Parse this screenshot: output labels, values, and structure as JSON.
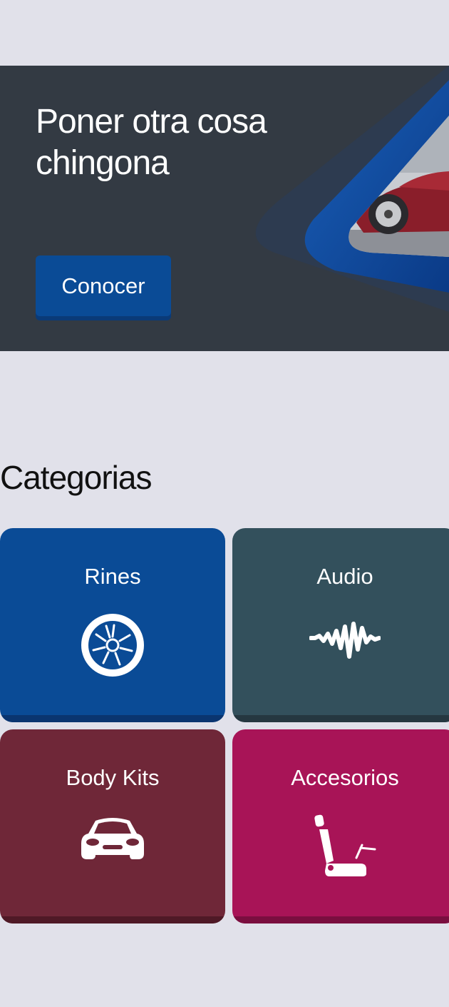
{
  "hero": {
    "title": "Poner otra cosa chingona",
    "button_label": "Conocer"
  },
  "categories_section": {
    "title": "Categorias",
    "items": [
      {
        "label": "Rines",
        "icon": "wheel-icon",
        "color": "#0a4b96"
      },
      {
        "label": "Audio",
        "icon": "audio-wave-icon",
        "color": "#33505c"
      },
      {
        "label": "Body Kits",
        "icon": "car-icon",
        "color": "#6f2738"
      },
      {
        "label": "Accesorios",
        "icon": "car-seat-icon",
        "color": "#a81457"
      }
    ]
  },
  "colors": {
    "background": "#e1e1ea",
    "hero_bg": "#333a43",
    "accent_blue": "#0a4b96"
  }
}
